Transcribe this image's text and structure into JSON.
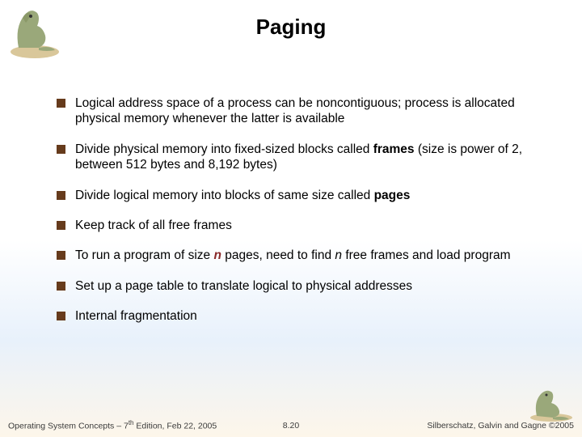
{
  "title": "Paging",
  "bullets": [
    {
      "html": "Logical address space of a process can be noncontiguous; process is allocated physical memory whenever the latter is available"
    },
    {
      "html": "Divide physical memory into fixed-sized blocks called <b>frames</b> (size is power of 2, between 512 bytes and 8,192 bytes)"
    },
    {
      "html": "Divide logical memory into blocks of same size called <b>pages</b>"
    },
    {
      "html": "Keep track of all free frames"
    },
    {
      "html": "To run a program of size <span class=\"italic-n\">n</span> pages, need to find <span class=\"italic-n2\">n</span> free frames and load program"
    },
    {
      "html": "Set up a page table to translate logical to physical addresses"
    },
    {
      "html": "Internal fragmentation"
    }
  ],
  "footer": {
    "left_pre": "Operating System Concepts – 7",
    "left_sup": "th",
    "left_post": " Edition, Feb 22, 2005",
    "center": "8.20",
    "right": "Silberschatz, Galvin and Gagne ©2005"
  },
  "icons": {
    "top_logo": "dinosaur-book-logo",
    "bottom_logo": "dinosaur-book-logo-small"
  }
}
